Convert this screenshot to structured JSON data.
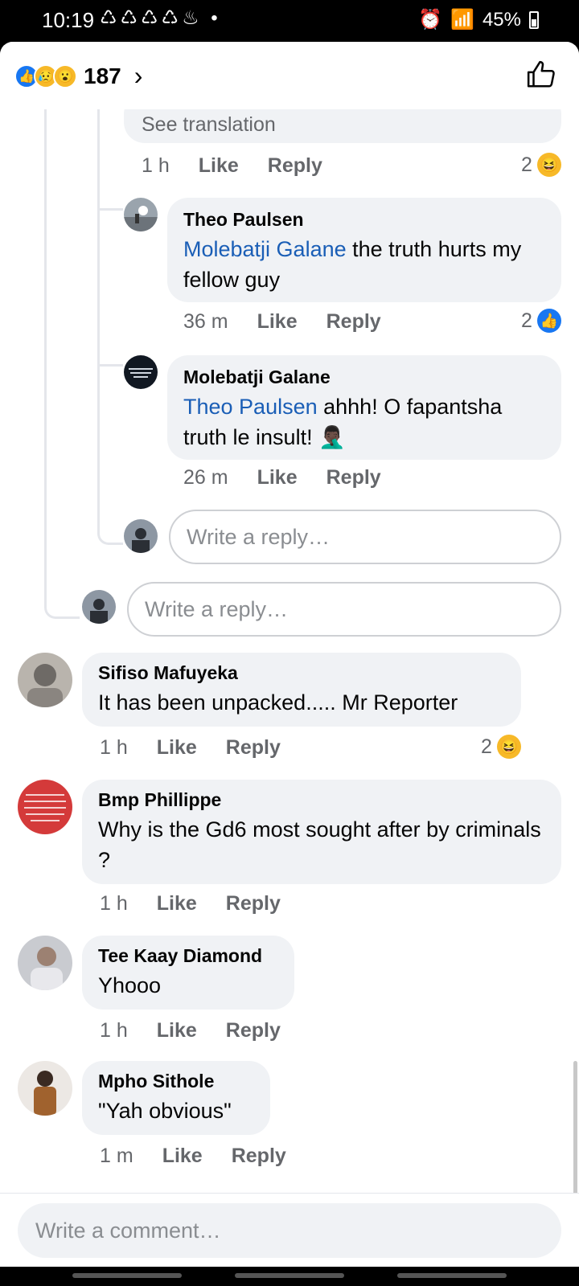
{
  "status": {
    "time": "10:19",
    "notif_icons": "♺♺♺♺♨ •",
    "battery": "45%"
  },
  "header": {
    "reaction_count": "187"
  },
  "comments": {
    "see_translation": "See translation",
    "top_meta": {
      "time": "1 h",
      "like": "Like",
      "reply": "Reply",
      "count": "2"
    },
    "r1": {
      "name": "Theo Paulsen",
      "mention": "Molebatji Galane",
      "text": " the truth hurts my fellow guy",
      "time": "36 m",
      "like": "Like",
      "reply": "Reply",
      "count": "2"
    },
    "r2": {
      "name": "Molebatji Galane",
      "mention": "Theo Paulsen",
      "text": " ahhh! O fapantsha truth le insult! 🤦🏿‍♂️",
      "time": "26 m",
      "like": "Like",
      "reply": "Reply"
    },
    "reply_placeholder": "Write a reply…",
    "c1": {
      "name": "Sifiso Mafuyeka",
      "text": "It has been unpacked..... Mr Reporter",
      "time": "1 h",
      "like": "Like",
      "reply": "Reply",
      "count": "2"
    },
    "c2": {
      "name": "Bmp Phillippe",
      "text": "Why is the Gd6 most sought after by criminals ?",
      "time": "1 h",
      "like": "Like",
      "reply": "Reply"
    },
    "c3": {
      "name": "Tee Kaay Diamond",
      "text": "Yhooo",
      "time": "1 h",
      "like": "Like",
      "reply": "Reply"
    },
    "c4": {
      "name": "Mpho Sithole",
      "text": "\"Yah obvious\"",
      "time": "1 m",
      "like": "Like",
      "reply": "Reply"
    }
  },
  "footer": {
    "placeholder": "Write a comment…"
  },
  "colors": {
    "link": "#1a5eb6",
    "bubble": "#f0f2f5",
    "meta": "#65676b"
  }
}
